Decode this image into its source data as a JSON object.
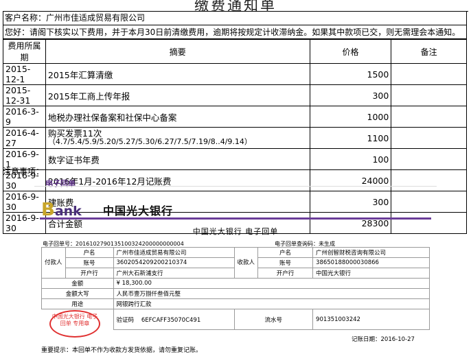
{
  "title": "缴费通知单",
  "customer": "客户名称：广州市佳适成贸易有限公司",
  "notice": "您好：请阁下核实以下费用，并于本月30日前清缴费用，逾期将按规定计收滞纳金。如果其中款项已交，则无需理会本通知。",
  "headers": {
    "date": "费用所属期",
    "summary": "摘要",
    "price": "价格",
    "note": "备注"
  },
  "rows": [
    {
      "date": "2015-12-1",
      "summary": "2015年汇算清缴",
      "price": "1500"
    },
    {
      "date": "2015-12-31",
      "summary": "2015年工商上传年报",
      "price": "300"
    },
    {
      "date": "2016-3-9",
      "summary": "地税办理社保备案和社保中心备案",
      "price": "1000"
    },
    {
      "date": "2016-4-27",
      "summary": "购买发票11次",
      "summary2": "（4.7/5.4/5.9/5.20/5.27/5.30/6.27/7.5/7.19/8..4/9.14）",
      "price": "1100"
    },
    {
      "date": "2016-9-1",
      "summary": "数字证书年费",
      "price": "100"
    },
    {
      "date": "2016-9-30",
      "summary": "2016年1月-2016年12月记账费",
      "price": "24000"
    },
    {
      "date": "2016-9-30",
      "summary": "建账费",
      "price": "300"
    },
    {
      "date": "2016-9-30",
      "summary": "合计金额",
      "price": "28300"
    }
  ],
  "notes_label": "注意事项：",
  "receipt": {
    "e_title": "电子回单",
    "bank_logo_b": "B",
    "bank_logo_rest": "ank",
    "bank_name": "中国光大银行",
    "heading": "中国光大银行  电子回单",
    "receipt_no": "电子回单号：2016102790135100324200000000004",
    "query_code": "电子回单查询码：未生成",
    "payer_label": "付款人",
    "payee_label": "收款人",
    "name_label": "户名",
    "account_label": "账号",
    "bank_label": "开户行",
    "payer_name": "广州市佳适成贸易有限公司",
    "payer_account": "36020542092002103​74",
    "payer_bank": "广州大石新浦支行",
    "payee_name": "广州创智财税咨询有限公司",
    "payee_account": "38650188000030866",
    "payee_bank": "中国光大银行",
    "amount_label": "金额",
    "amount": "¥  18,300.00",
    "amount_words_label": "金额大写",
    "amount_words": "人民币壹万捌仟叁佰元整",
    "purpose_label": "用途",
    "purpose": "网银跨行汇款",
    "verify_label": "验证码",
    "verify": "6EFCAFF35070C491",
    "serial_label": "流水号",
    "serial": "901351003242",
    "stamp": "中国光大银行 电子回单 专用章",
    "date": "记账日期：2016-10-27",
    "tip": "重要提示：本回单不作为收款方发货依据，请勿重复记账。"
  }
}
